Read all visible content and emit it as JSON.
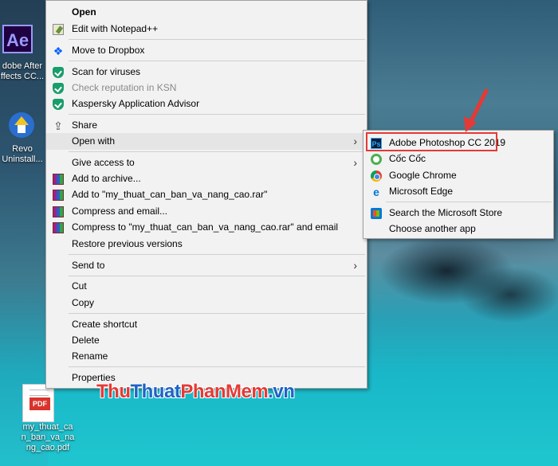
{
  "desktop": {
    "icons": [
      {
        "label_lines": [
          "dobe After",
          "ffects CC..."
        ],
        "icon": "after-effects-icon",
        "tile_text": "Ae"
      },
      {
        "label_lines": [
          "Revo",
          "Uninstall..."
        ],
        "icon": "revo-uninstaller-icon"
      },
      {
        "label_lines": [
          "my_thuat_ca",
          "n_ban_va_na",
          "ng_cao.pdf"
        ],
        "icon": "pdf-file-icon",
        "tile_text": "PDF"
      }
    ]
  },
  "context_menu": {
    "items": [
      {
        "label": "Open",
        "icon": "",
        "bold": true
      },
      {
        "label": "Edit with Notepad++",
        "icon": "notepad-plus-icon"
      },
      {
        "label": "Move to Dropbox",
        "icon": "dropbox-icon"
      },
      {
        "label": "Scan for viruses",
        "icon": "kaspersky-shield-icon"
      },
      {
        "label": "Check reputation in KSN",
        "icon": "kaspersky-shield-icon",
        "disabled": true
      },
      {
        "label": "Kaspersky Application Advisor",
        "icon": "kaspersky-shield-icon"
      },
      {
        "label": "Share",
        "icon": "share-icon"
      },
      {
        "label": "Open with",
        "icon": "",
        "submenu": true,
        "hover": true
      },
      {
        "label": "Give access to",
        "icon": "",
        "submenu": true
      },
      {
        "label": "Add to archive...",
        "icon": "winrar-icon"
      },
      {
        "label": "Add to \"my_thuat_can_ban_va_nang_cao.rar\"",
        "icon": "winrar-icon"
      },
      {
        "label": "Compress and email...",
        "icon": "winrar-icon"
      },
      {
        "label": "Compress to \"my_thuat_can_ban_va_nang_cao.rar\" and email",
        "icon": "winrar-icon"
      },
      {
        "label": "Restore previous versions",
        "icon": ""
      },
      {
        "label": "Send to",
        "icon": "",
        "submenu": true
      },
      {
        "label": "Cut",
        "icon": ""
      },
      {
        "label": "Copy",
        "icon": ""
      },
      {
        "label": "Create shortcut",
        "icon": ""
      },
      {
        "label": "Delete",
        "icon": ""
      },
      {
        "label": "Rename",
        "icon": ""
      },
      {
        "label": "Properties",
        "icon": ""
      }
    ]
  },
  "open_with_submenu": {
    "items": [
      {
        "label": "Adobe Photoshop CC 2019",
        "icon": "photoshop-icon",
        "icon_text": "Ps",
        "highlighted": true
      },
      {
        "label": "Cốc Cốc",
        "icon": "coccoc-icon"
      },
      {
        "label": "Google Chrome",
        "icon": "chrome-icon"
      },
      {
        "label": "Microsoft Edge",
        "icon": "edge-icon",
        "icon_text": "e"
      },
      {
        "label": "Search the Microsoft Store",
        "icon": "microsoft-store-icon"
      },
      {
        "label": "Choose another app",
        "icon": ""
      }
    ]
  },
  "watermark": {
    "parts": [
      "Thu",
      "Thuat",
      "PhanMem",
      ".vn"
    ]
  },
  "colors": {
    "highlight_border": "#e53935",
    "menu_bg": "#f2f2f2",
    "hover_bg": "#e5e5e5"
  }
}
